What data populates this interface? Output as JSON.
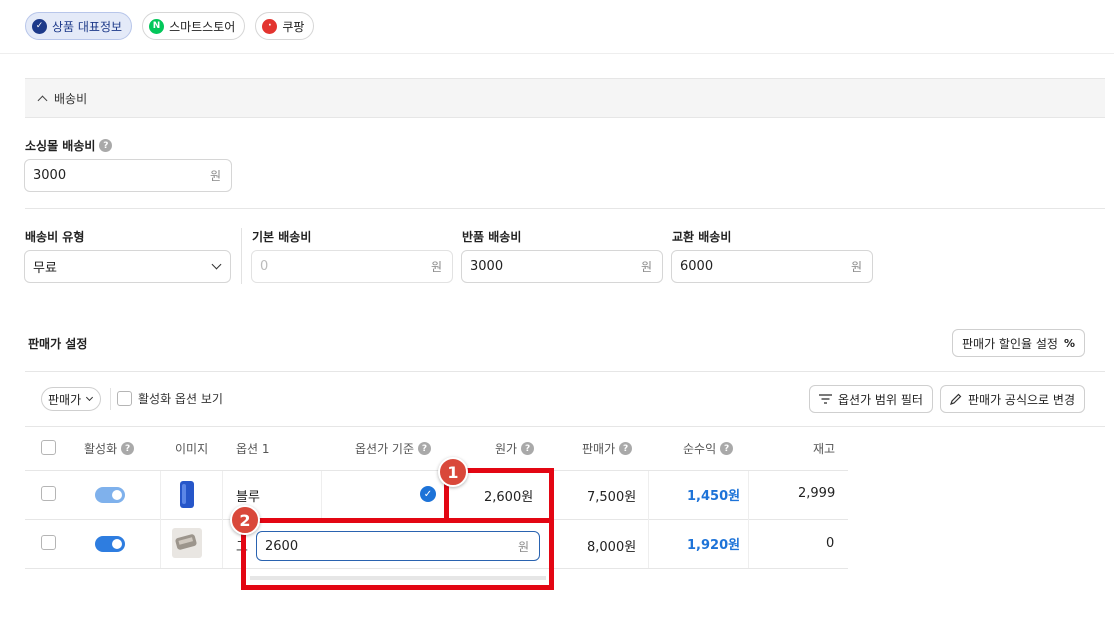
{
  "tabs": [
    {
      "label": "상품 대표정보",
      "icon": "check-circle-icon",
      "active": true
    },
    {
      "label": "스마트스토어",
      "icon": "naver-icon",
      "active": false
    },
    {
      "label": "쿠팡",
      "icon": "coupang-icon",
      "active": false
    }
  ],
  "shipping": {
    "section_title": "배송비",
    "shopping_mall_fee": {
      "label": "소싱몰 배송비",
      "value": "3000",
      "unit": "원"
    },
    "fee_type": {
      "label": "배송비 유형",
      "value": "무료"
    },
    "base_fee": {
      "label": "기본 배송비",
      "placeholder": "0",
      "unit": "원"
    },
    "return_fee": {
      "label": "반품 배송비",
      "value": "3000",
      "unit": "원"
    },
    "exchange_fee": {
      "label": "교환 배송비",
      "value": "6000",
      "unit": "원"
    }
  },
  "pricing": {
    "title": "판매가 설정",
    "discount_button": "판매가 할인율 설정",
    "price_dropdown": "판매가",
    "show_active_label": "활성화 옵션 보기",
    "range_filter_button": "옵션가 범위 필터",
    "formula_button": "판매가 공식으로 변경"
  },
  "table": {
    "headers": [
      "활성화",
      "이미지",
      "옵션 1",
      "옵션가 기준",
      "원가",
      "판매가",
      "순수익",
      "재고"
    ],
    "rows": [
      {
        "option": "블루",
        "cost": "2,600원",
        "price": "7,500원",
        "profit": "1,450원",
        "stock": "2,999",
        "base": true,
        "active": true
      },
      {
        "option": "그",
        "cost": "",
        "price": "8,000원",
        "profit": "1,920원",
        "stock": "0",
        "base": false,
        "active": true
      }
    ],
    "edit_value": "2600",
    "edit_unit": "원"
  },
  "annotations": {
    "badge1": "1",
    "badge2": "2",
    "color": "#e30613"
  }
}
